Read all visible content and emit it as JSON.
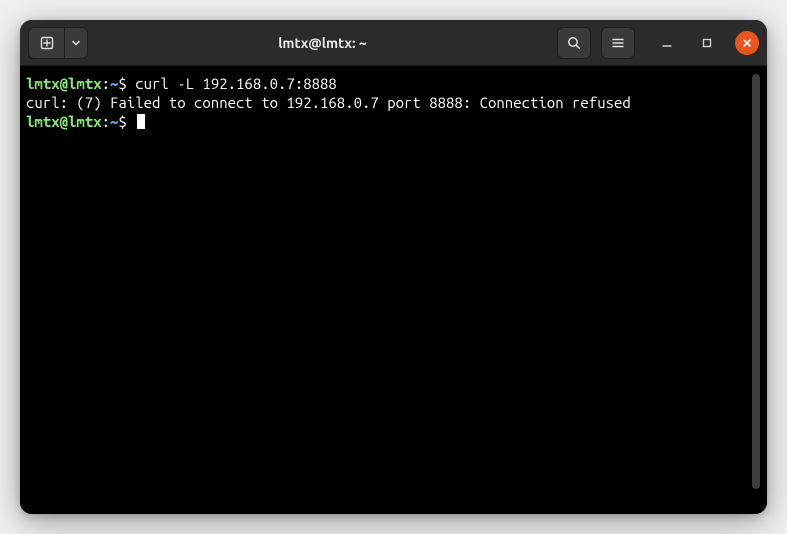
{
  "titlebar": {
    "title": "lmtx@lmtx: ~"
  },
  "prompt": {
    "user_host": "lmtx@lmtx",
    "separator": ":",
    "path": "~",
    "symbol": "$"
  },
  "lines": {
    "command1": "curl -L 192.168.0.7:8888",
    "output1": "curl: (7) Failed to connect to 192.168.0.7 port 8888: Connection refused"
  },
  "icons": {
    "newtab": "new-tab-icon",
    "dropdown": "chevron-down-icon",
    "search": "search-icon",
    "menu": "hamburger-icon",
    "minimize": "minimize-icon",
    "maximize": "maximize-icon",
    "close": "close-icon"
  }
}
